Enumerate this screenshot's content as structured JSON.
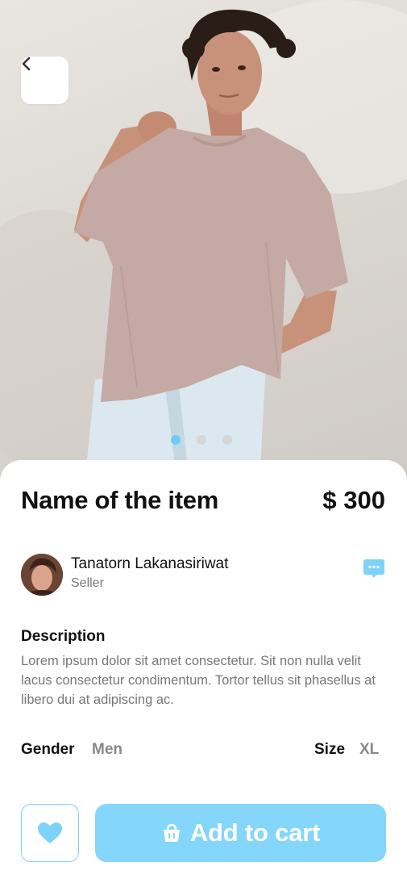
{
  "product": {
    "name": "Name of the item",
    "price": "$ 300",
    "image_icon": "product-photo",
    "carousel": {
      "count": 3,
      "active": 0
    }
  },
  "seller": {
    "name": "Tanatorn Lakanasiriwat",
    "role": "Seller"
  },
  "description": {
    "heading": "Description",
    "text": "Lorem ipsum dolor sit amet consectetur. Sit non nulla velit lacus consectetur condimentum. Tortor tellus sit phasellus at libero dui at adipiscing ac."
  },
  "attributes": {
    "gender_label": "Gender",
    "gender_value": "Men",
    "size_label": "Size",
    "size_value": "XL"
  },
  "actions": {
    "add_to_cart": "Add to cart"
  },
  "icons": {
    "back": "chevron-left-icon",
    "chat": "chat-bubble-icon",
    "favorite": "heart-icon",
    "cart": "basket-icon"
  },
  "colors": {
    "accent": "#84d6fa",
    "accent_border": "#7dd3f7",
    "heading": "#111111",
    "muted": "#777777"
  }
}
